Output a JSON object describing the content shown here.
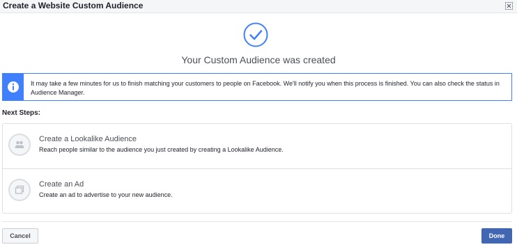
{
  "dialog": {
    "title": "Create a Website Custom Audience",
    "close_icon": "close-icon"
  },
  "success": {
    "icon": "checkmark-circle-icon",
    "message": "Your Custom Audience was created"
  },
  "notice": {
    "icon": "info-icon",
    "text": "It may take a few minutes for us to finish matching your customers to people on Facebook. We'll notify you when this process is finished. You can also check the status in Audience Manager."
  },
  "next_steps": {
    "heading": "Next Steps:",
    "items": [
      {
        "icon": "people-icon",
        "title": "Create a Lookalike Audience",
        "description": "Reach people similar to the audience you just created by creating a Lookalike Audience."
      },
      {
        "icon": "ad-icon",
        "title": "Create an Ad",
        "description": "Create an ad to advertise to your new audience."
      }
    ]
  },
  "footer": {
    "cancel_label": "Cancel",
    "done_label": "Done"
  },
  "colors": {
    "accent": "#4080ff",
    "primary_button": "#4267b2",
    "border": "#dddfe2"
  }
}
